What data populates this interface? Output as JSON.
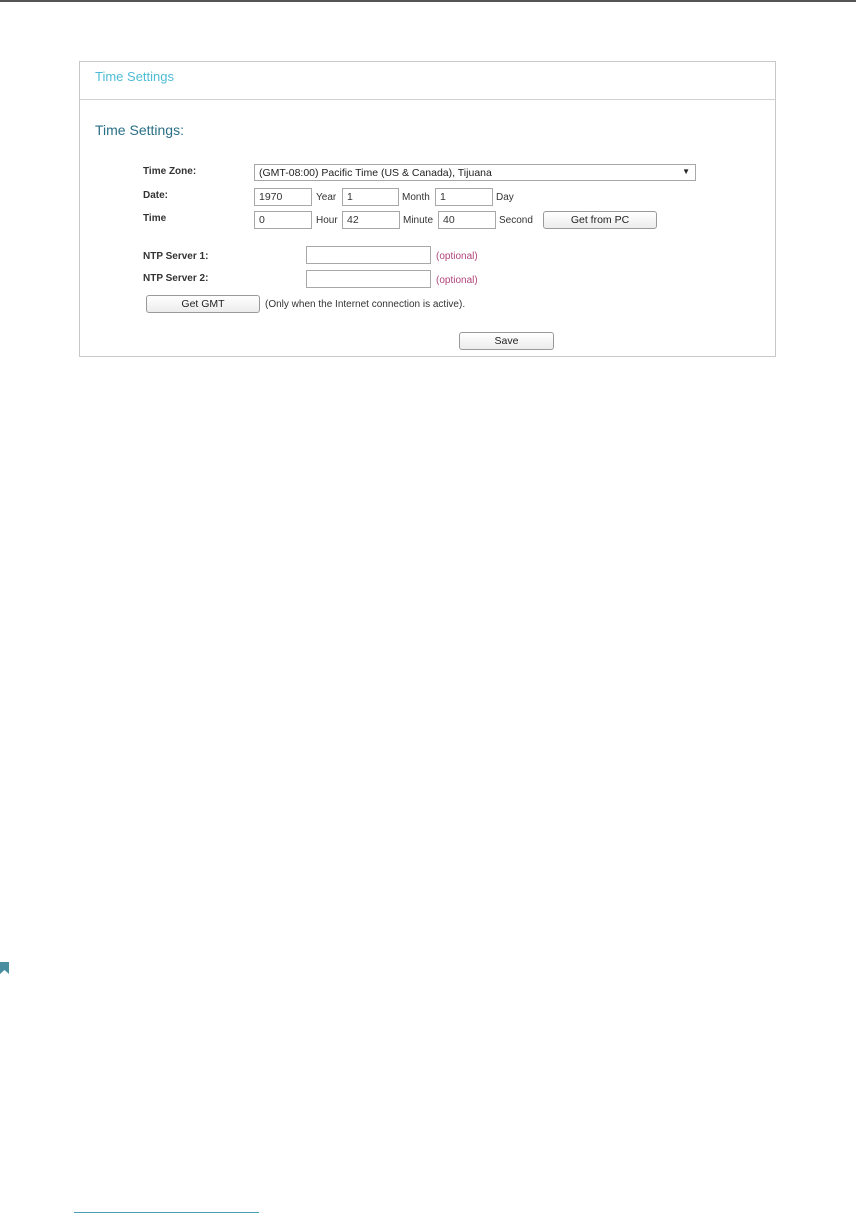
{
  "panel": {
    "title": "Time Settings",
    "section_heading": "Time Settings:"
  },
  "time_zone": {
    "label": "Time Zone:",
    "selected": "(GMT-08:00) Pacific Time (US & Canada), Tijuana"
  },
  "date": {
    "label": "Date:",
    "year_value": "1970",
    "year_unit": "Year",
    "month_value": "1",
    "month_unit": "Month",
    "day_value": "1",
    "day_unit": "Day"
  },
  "time": {
    "label": "Time",
    "hour_value": "0",
    "hour_unit": "Hour",
    "minute_value": "42",
    "minute_unit": "Minute",
    "second_value": "40",
    "second_unit": "Second",
    "get_from_pc_label": "Get from PC"
  },
  "ntp": {
    "server1_label": "NTP Server 1:",
    "server1_value": "",
    "server2_label": "NTP Server 2:",
    "server2_value": "",
    "optional_text": "(optional)"
  },
  "gmt": {
    "button_label": "Get GMT",
    "note": "(Only when the Internet connection is active)."
  },
  "save_label": "Save",
  "colors": {
    "title_accent": "#4dbdd6",
    "heading": "#2a6f86",
    "optional": "#b0457a",
    "bookmark": "#4a8fa0"
  }
}
